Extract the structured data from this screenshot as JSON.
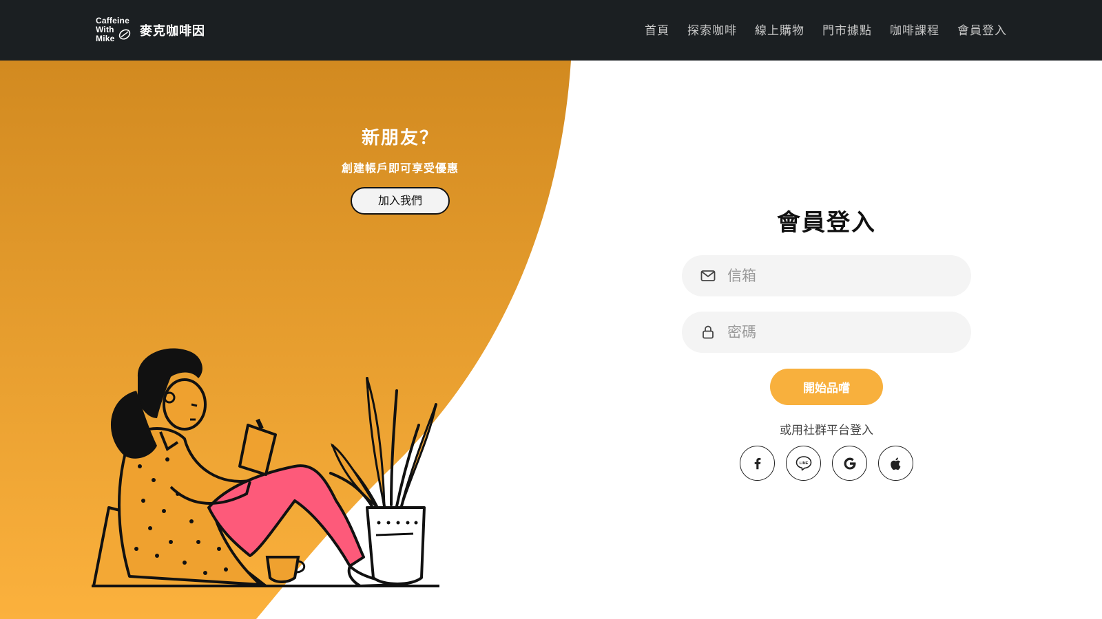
{
  "header": {
    "logo_lines": [
      "Caffeine",
      "With",
      "Mike"
    ],
    "brand_name": "麥克咖啡因",
    "nav": [
      "首頁",
      "探索咖啡",
      "線上購物",
      "門市據點",
      "咖啡課程",
      "會員登入"
    ]
  },
  "promo": {
    "title": "新朋友？",
    "subtitle": "創建帳戶即可享受優惠",
    "join_button": "加入我們"
  },
  "login": {
    "title": "會員登入",
    "email_placeholder": "信箱",
    "password_placeholder": "密碼",
    "submit_button": "開始品嚐",
    "social_label": "或用社群平台登入",
    "social_icons": [
      "facebook-icon",
      "line-icon",
      "google-icon",
      "apple-icon"
    ],
    "line_icon_text": "LINE"
  },
  "colors": {
    "header_bg": "#1b1f22",
    "orange_top": "#d28a20",
    "orange_bottom": "#fbb13d",
    "button_accent": "#f8b03d",
    "pants_pink": "#fd5a7a"
  }
}
